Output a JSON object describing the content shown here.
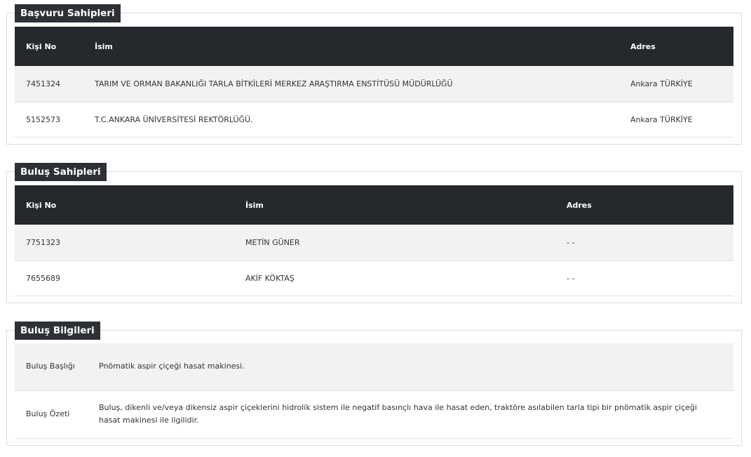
{
  "applicants": {
    "title": "Başvuru Sahipleri",
    "columns": {
      "id": "Kişi No",
      "name": "İsim",
      "address": "Adres"
    },
    "rows": [
      {
        "id": "7451324",
        "name": "TARIM VE ORMAN BAKANLIĞI TARLA BİTKİLERİ MERKEZ ARAŞTIRMA ENSTİTÜSÜ MÜDÜRLÜĞÜ",
        "address": "Ankara TÜRKİYE"
      },
      {
        "id": "5152573",
        "name": "T.C.ANKARA ÜNİVERSİTESİ REKTÖRLÜĞÜ.",
        "address": "Ankara TÜRKİYE"
      }
    ]
  },
  "inventors": {
    "title": "Buluş Sahipleri",
    "columns": {
      "id": "Kişi No",
      "name": "İsim",
      "address": "Adres"
    },
    "rows": [
      {
        "id": "7751323",
        "name": "METİN GÜNER",
        "address": "- -"
      },
      {
        "id": "7655689",
        "name": "AKİF KÖKTAŞ",
        "address": "- -"
      }
    ]
  },
  "invention": {
    "title": "Buluş Bilgileri",
    "rows": [
      {
        "label": "Buluş Başlığı",
        "value": "Pnömatik aspir çiçeği hasat makinesi."
      },
      {
        "label": "Buluş Özeti",
        "value": "Buluş, dikenli ve/veya dikensiz aspir çiçeklerini hidrolik sistem ile negatif basınçlı hava ile hasat eden, traktöre asılabilen tarla tipi bir pnömatik aspir çiçeği hasat makinesi ile ilgilidir."
      }
    ]
  }
}
